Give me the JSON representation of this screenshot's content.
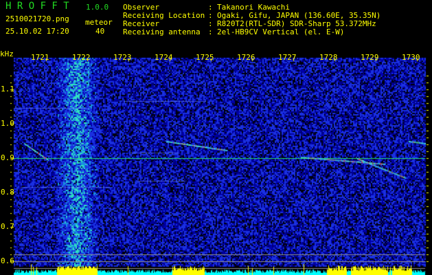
{
  "header": {
    "app_name": "H R O F F T",
    "version": "1.0.0",
    "filename": "2510021720.png",
    "datetime": "25.10.02 17:20",
    "meteor_label": "meteor",
    "meteor_count": "40",
    "info": [
      {
        "label": "Observer",
        "value": "Takanori Kawachi"
      },
      {
        "label": "Receiving Location",
        "value": "Ogaki, Gifu, JAPAN (136.60E, 35.35N)"
      },
      {
        "label": "Receiver",
        "value": "R820T2(RTL-SDR) SDR-Sharp 53.372MHz"
      },
      {
        "label": "Receiving antenna",
        "value": "2el-HB9CV Vertical (el. E-W)"
      }
    ]
  },
  "chart_data": {
    "type": "heatmap",
    "ylabel": "kHz",
    "x_ticks": [
      "1721",
      "1722",
      "1723",
      "1724",
      "1725",
      "1726",
      "1727",
      "1728",
      "1729",
      "1730"
    ],
    "y_ticks": [
      "1.1",
      "1.0",
      "0.9",
      "0.8",
      "0.7",
      "0.6"
    ],
    "xlim": [
      1720.2,
      1730.2
    ],
    "ylim": [
      0.56,
      1.2
    ],
    "reference_line_khz": 0.9,
    "gray_lines_khz": [
      0.62,
      0.6,
      0.58
    ],
    "colors": {
      "background": "#000000",
      "noise": "#1020c0",
      "strong": "#30e0e0",
      "reference": "#20e070",
      "text": "#ffff00",
      "level_low": "#00ffff",
      "level_high": "#ffff00"
    },
    "meteor_traces": [
      {
        "start": [
          1720.47,
          0.944
        ],
        "end": [
          1721.05,
          0.896
        ]
      },
      {
        "start": [
          1723.92,
          0.95
        ],
        "end": [
          1725.38,
          0.924
        ]
      },
      {
        "start": [
          1727.18,
          0.904
        ],
        "end": [
          1729.22,
          0.884
        ]
      },
      {
        "start": [
          1728.55,
          0.9
        ],
        "end": [
          1729.72,
          0.844
        ]
      },
      {
        "start": [
          1729.8,
          0.95
        ],
        "end": [
          1730.2,
          0.944
        ]
      }
    ],
    "strong_band_minutes": [
      1721.4,
      1722.1
    ]
  }
}
